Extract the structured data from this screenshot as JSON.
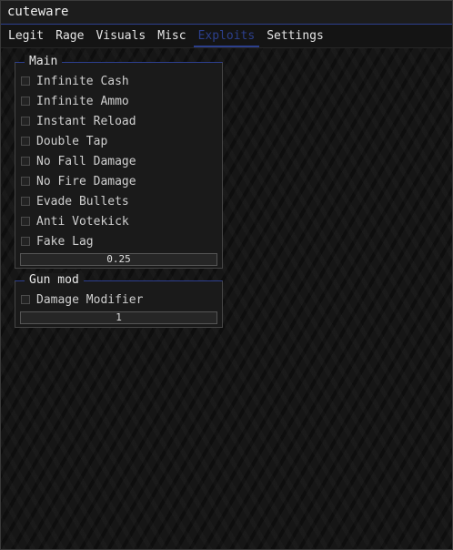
{
  "window": {
    "title": "cuteware"
  },
  "tabs": [
    {
      "label": "Legit",
      "active": false
    },
    {
      "label": "Rage",
      "active": false
    },
    {
      "label": "Visuals",
      "active": false
    },
    {
      "label": "Misc",
      "active": false
    },
    {
      "label": "Exploits",
      "active": true
    },
    {
      "label": "Settings",
      "active": false
    }
  ],
  "groups": {
    "main": {
      "title": "Main",
      "options": [
        {
          "label": "Infinite Cash",
          "checked": false
        },
        {
          "label": "Infinite Ammo",
          "checked": false
        },
        {
          "label": "Instant Reload",
          "checked": false
        },
        {
          "label": "Double Tap",
          "checked": false
        },
        {
          "label": "No Fall Damage",
          "checked": false
        },
        {
          "label": "No Fire Damage",
          "checked": false
        },
        {
          "label": "Evade Bullets",
          "checked": false
        },
        {
          "label": "Anti Votekick",
          "checked": false
        },
        {
          "label": "Fake Lag",
          "checked": false
        }
      ],
      "slider_value": "0.25"
    },
    "gunmod": {
      "title": "Gun mod",
      "options": [
        {
          "label": "Damage Modifier",
          "checked": false
        }
      ],
      "slider_value": "1"
    }
  },
  "colors": {
    "accent": "#2c3f8c",
    "background": "#161616",
    "border": "#454545"
  }
}
